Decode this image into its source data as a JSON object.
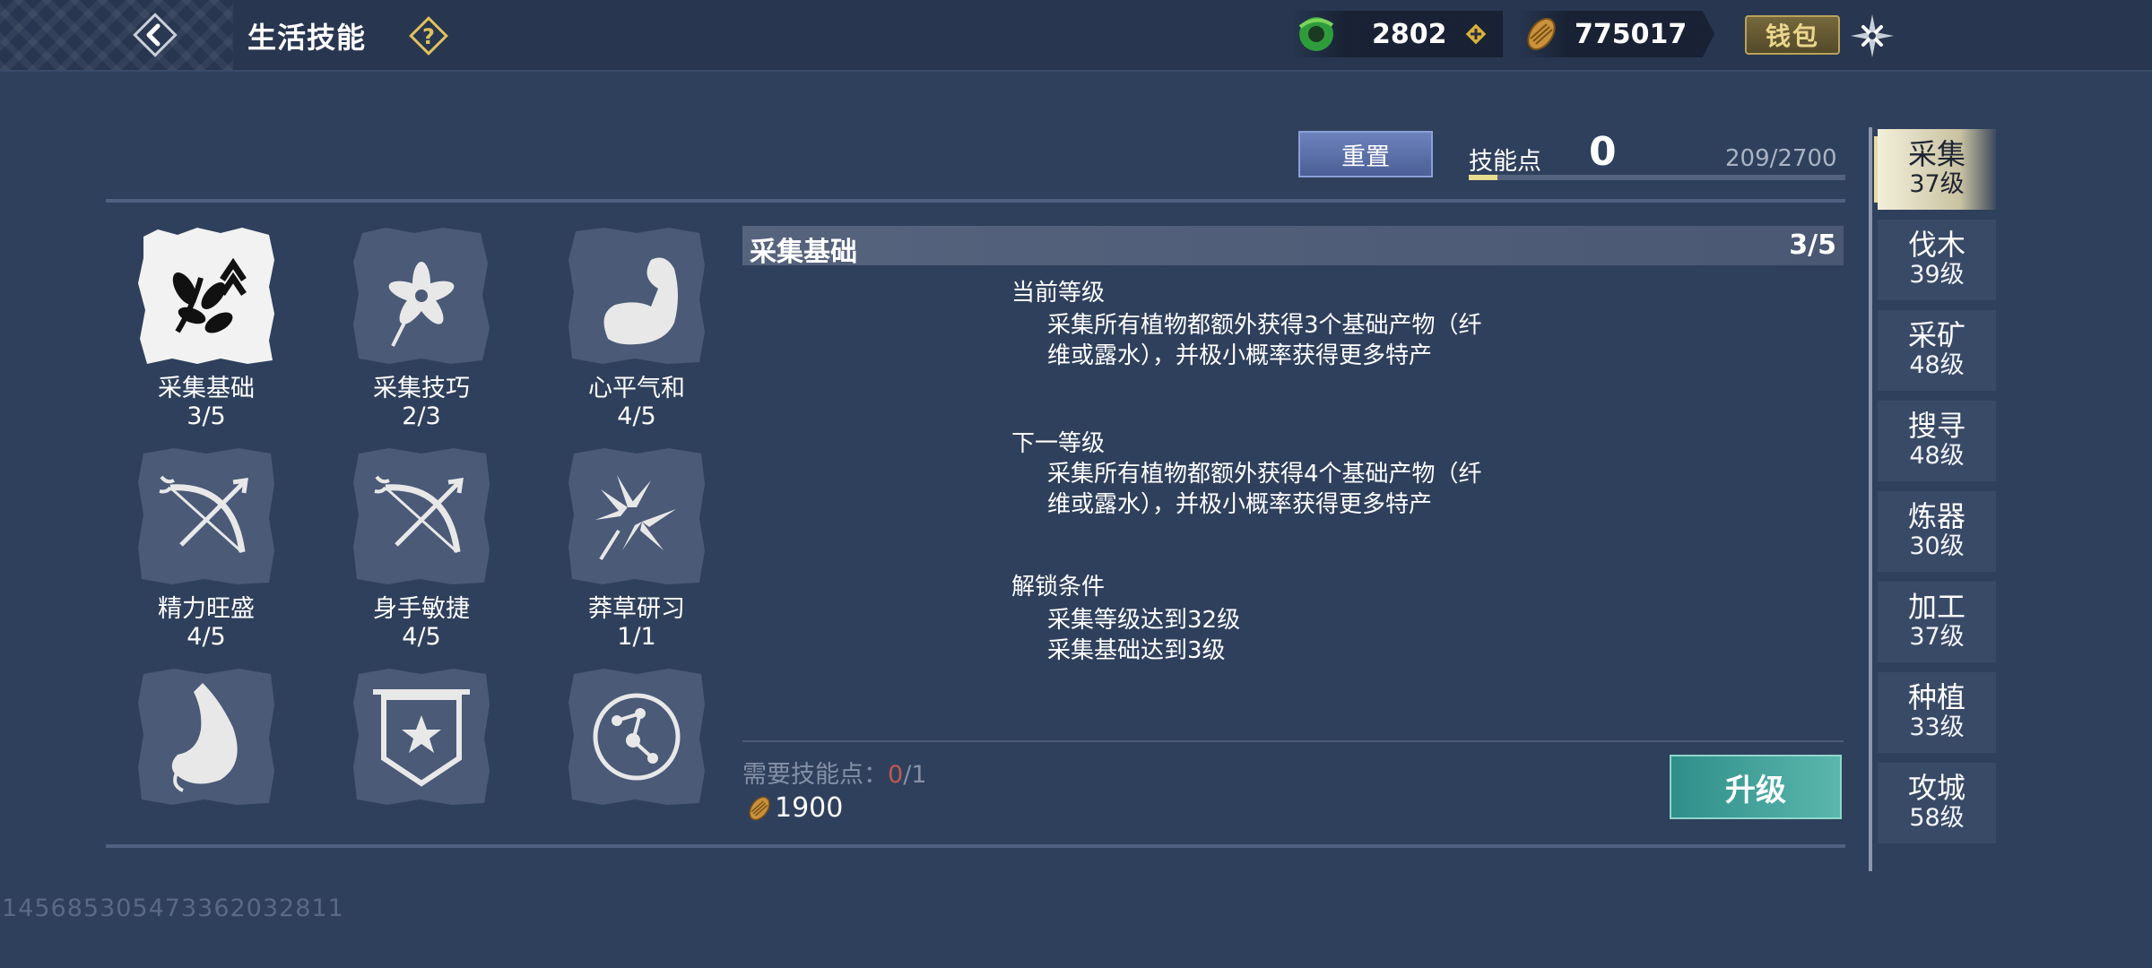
{
  "header": {
    "title": "生活技能",
    "jade_value": "2802",
    "coin_value": "775017",
    "wallet_label": "钱包"
  },
  "skill_points": {
    "reset_label": "重置",
    "label": "技能点",
    "value": "0",
    "exp_text": "209/2700",
    "exp_fraction": 0.077
  },
  "skills": [
    {
      "name": "采集基础",
      "level": "3/5",
      "icon": "gather-basic-icon"
    },
    {
      "name": "采集技巧",
      "level": "2/3",
      "icon": "flower-icon"
    },
    {
      "name": "心平气和",
      "level": "4/5",
      "icon": "muscle-arm-icon"
    },
    {
      "name": "精力旺盛",
      "level": "4/5",
      "icon": "bow-icon"
    },
    {
      "name": "身手敏捷",
      "level": "4/5",
      "icon": "bow-icon"
    },
    {
      "name": "莽草研习",
      "level": "1/1",
      "icon": "herb-icon"
    },
    {
      "name": "",
      "level": "",
      "icon": "stomach-icon"
    },
    {
      "name": "",
      "level": "",
      "icon": "star-banner-icon"
    },
    {
      "name": "",
      "level": "",
      "icon": "constellation-icon"
    }
  ],
  "detail": {
    "name": "采集基础",
    "level": "3/5",
    "current_title": "当前等级",
    "current_desc_1": "采集所有植物都额外获得3个基础产物（纤",
    "current_desc_2": "维或露水），并极小概率获得更多特产",
    "next_title": "下一等级",
    "next_desc_1": "采集所有植物都额外获得4个基础产物（纤",
    "next_desc_2": "维或露水），并极小概率获得更多特产",
    "unlock_title": "解锁条件",
    "unlock_1": "采集等级达到32级",
    "unlock_2": "采集基础达到3级",
    "need_label": "需要技能点：",
    "need_current": "0",
    "need_total": "/1",
    "coin_cost": "1900",
    "upgrade_label": "升级"
  },
  "tabs": [
    {
      "name": "采集",
      "level": "37级",
      "active": true
    },
    {
      "name": "伐木",
      "level": "39级"
    },
    {
      "name": "采矿",
      "level": "48级"
    },
    {
      "name": "搜寻",
      "level": "48级"
    },
    {
      "name": "炼器",
      "level": "30级"
    },
    {
      "name": "加工",
      "level": "37级"
    },
    {
      "name": "种植",
      "level": "33级"
    },
    {
      "name": "攻城",
      "level": "58级"
    }
  ],
  "footer": {
    "uid": "14568530547336203281​1"
  },
  "colors": {
    "background": "#2f405c",
    "accent_gold": "#e8dd8f",
    "upgrade_teal": "#4fa9a0",
    "reset_blue": "#5f73ac"
  }
}
